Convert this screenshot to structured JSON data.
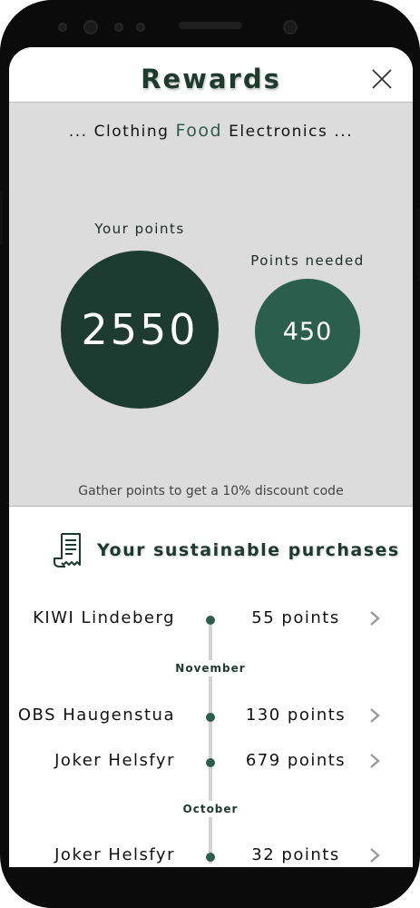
{
  "header": {
    "title": "Rewards"
  },
  "categories": [
    "...",
    "Clothing",
    "Food",
    "Electronics",
    "..."
  ],
  "points": {
    "your_label": "Your points",
    "your_value": "2550",
    "needed_label": "Points needed",
    "needed_value": "450",
    "info": "Gather points to get a 10% discount code"
  },
  "purchases": {
    "title": "Your sustainable purchases",
    "items": [
      {
        "store": "KIWI Lindeberg",
        "points": "55 points"
      },
      {
        "store": "OBS Haugenstua",
        "points": "130 points"
      },
      {
        "store": "Joker Helsfyr",
        "points": "679 points"
      },
      {
        "store": "Joker Helsfyr",
        "points": "32 points"
      }
    ],
    "months": [
      "November",
      "October"
    ]
  },
  "colors": {
    "dark_green": "#1d3b30",
    "mid_green": "#2b5e4d",
    "panel_grey": "#dcdcdc"
  },
  "icons": [
    "close-icon",
    "receipt-icon",
    "chevron-right-icon"
  ]
}
